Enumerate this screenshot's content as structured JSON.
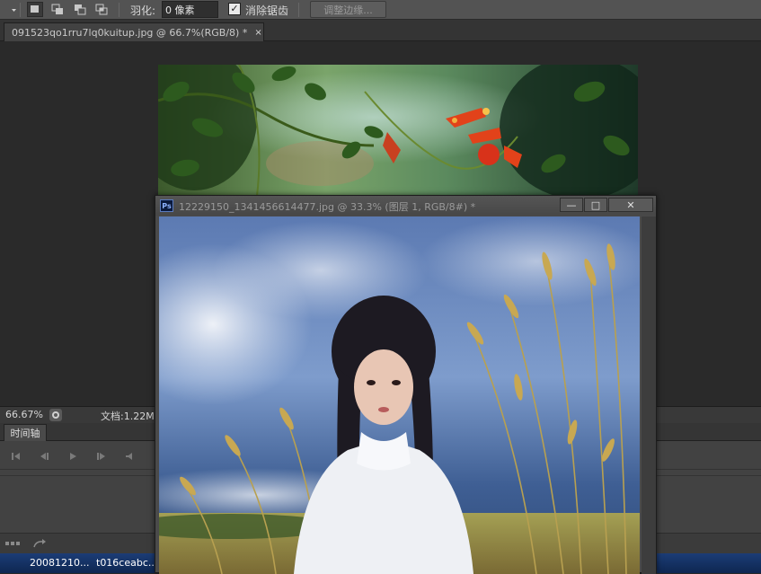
{
  "options_bar": {
    "feather_label": "羽化:",
    "feather_value": "0 像素",
    "antialias_label": "消除锯齿",
    "antialias_checked": "✓",
    "refine_edge_label": "调整边缘..."
  },
  "document_tab": {
    "title": "091523qo1rru7lq0kuitup.jpg @ 66.7%(RGB/8) *",
    "close_glyph": "×"
  },
  "status_bar": {
    "zoom": "66.67%",
    "doc_info": "文档:1.22M"
  },
  "timeline": {
    "tab_label": "时间轴"
  },
  "taskbar": {
    "items": [
      "20081210...",
      "t016ceabc..."
    ]
  },
  "floating_window": {
    "app_badge": "Ps",
    "title": "12229150_1341456614477.jpg @ 33.3% (图层 1, RGB/8#) *",
    "minimize_glyph": "—",
    "maximize_glyph": "□",
    "close_glyph": "✕"
  },
  "colors": {
    "panel_bg": "#282828",
    "options_bar_bg": "#535353",
    "taskbar_blue": "#1c3d76"
  }
}
